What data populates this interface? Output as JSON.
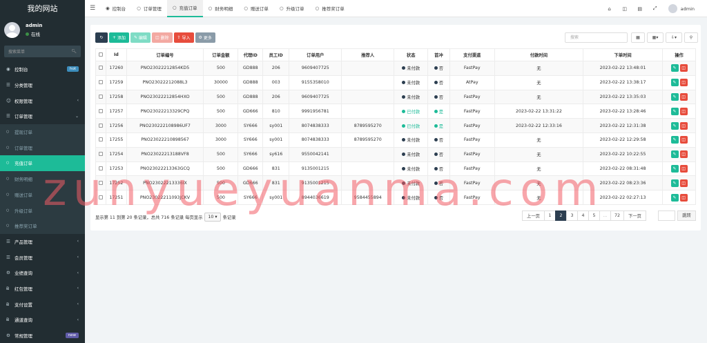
{
  "sidebar": {
    "logo": "我的网站",
    "user": {
      "name": "admin",
      "status": "在线"
    },
    "search_placeholder": "搜索菜单",
    "items": [
      {
        "label": "控制台",
        "icon": "dashboard-icon",
        "badge": "hot",
        "type": "parent"
      },
      {
        "label": "分类管理",
        "icon": "list-icon",
        "type": "parent"
      },
      {
        "label": "权限管理",
        "icon": "group-icon",
        "type": "parent",
        "chevron": true
      },
      {
        "label": "订单管理",
        "icon": "list-icon",
        "type": "parent",
        "chevron": true,
        "expanded": true
      },
      {
        "label": "提现订单",
        "icon": "circle-icon",
        "type": "sub"
      },
      {
        "label": "订单管理",
        "icon": "circle-icon",
        "type": "sub"
      },
      {
        "label": "充值订单",
        "icon": "circle-icon",
        "type": "sub",
        "active": true
      },
      {
        "label": "财务明细",
        "icon": "circle-icon",
        "type": "sub"
      },
      {
        "label": "赠送订单",
        "icon": "circle-icon",
        "type": "sub"
      },
      {
        "label": "升级订单",
        "icon": "circle-icon",
        "type": "sub"
      },
      {
        "label": "推荐奖订单",
        "icon": "circle-icon",
        "type": "sub"
      },
      {
        "label": "产品管理",
        "icon": "list-icon",
        "type": "parent",
        "chevron": true
      },
      {
        "label": "会员管理",
        "icon": "list-icon",
        "type": "parent",
        "chevron": true
      },
      {
        "label": "业绩查询",
        "icon": "gear-icon",
        "type": "parent",
        "chevron": true
      },
      {
        "label": "红包管理",
        "icon": "bitcoin-icon",
        "type": "parent",
        "chevron": true
      },
      {
        "label": "支付设置",
        "icon": "bitcoin-icon",
        "type": "parent",
        "chevron": true
      },
      {
        "label": "通道查询",
        "icon": "bitcoin-icon",
        "type": "parent",
        "chevron": true
      },
      {
        "label": "常规管理",
        "icon": "gear-icon",
        "badge": "new",
        "type": "parent"
      }
    ]
  },
  "topbar": {
    "tabs": [
      {
        "label": "控制台",
        "icon": "dashboard-icon"
      },
      {
        "label": "订单管理",
        "icon": "circle-icon"
      },
      {
        "label": "充值订单",
        "icon": "circle-icon",
        "active": true
      },
      {
        "label": "财务明细",
        "icon": "circle-icon"
      },
      {
        "label": "赠送订单",
        "icon": "circle-icon"
      },
      {
        "label": "升级订单",
        "icon": "circle-icon"
      },
      {
        "label": "推荐奖订单",
        "icon": "circle-icon"
      }
    ],
    "user": "admin"
  },
  "toolbar": {
    "add": "添加",
    "edit": "编辑",
    "delete": "删除",
    "import": "导入",
    "more": "更多",
    "search_placeholder": "搜索"
  },
  "table": {
    "headers": [
      "Id",
      "订单编号",
      "订单金额",
      "代理ID",
      "员工ID",
      "订单用户",
      "推荐人",
      "状态",
      "首冲",
      "支付渠道",
      "付款时间",
      "下单时间",
      "操作"
    ],
    "rows": [
      {
        "id": "17260",
        "order_no": "PNO23022212854KD5",
        "amount": "500",
        "agent": "GD888",
        "staff": "206",
        "user": "9609407725",
        "referrer": "",
        "status": "未付款",
        "paid": false,
        "first": "否",
        "channel": "FastPay",
        "pay_time": "无",
        "order_time": "2023-02-22 13:48:01"
      },
      {
        "id": "17259",
        "order_no": "PNO23022212088L3",
        "amount": "30000",
        "agent": "GD888",
        "staff": "003",
        "user": "9155358010",
        "referrer": "",
        "status": "未付款",
        "paid": false,
        "first": "否",
        "channel": "AtPay",
        "pay_time": "无",
        "order_time": "2023-02-22 13:38:17"
      },
      {
        "id": "17258",
        "order_no": "PNO23022212854HXO",
        "amount": "500",
        "agent": "GD888",
        "staff": "206",
        "user": "9609407725",
        "referrer": "",
        "status": "未付款",
        "paid": false,
        "first": "否",
        "channel": "FastPay",
        "pay_time": "无",
        "order_time": "2023-02-22 13:35:03"
      },
      {
        "id": "17257",
        "order_no": "PNO23022213329CPQ",
        "amount": "500",
        "agent": "GD666",
        "staff": "810",
        "user": "9991956781",
        "referrer": "",
        "status": "已付款",
        "paid": true,
        "first": "是",
        "channel": "FastPay",
        "pay_time": "2023-02-22 13:31:22",
        "order_time": "2023-02-22 13:28:46"
      },
      {
        "id": "17256",
        "order_no": "PNO230222108986UF7",
        "amount": "3000",
        "agent": "SY666",
        "staff": "sy001",
        "user": "8074838333",
        "referrer": "8789595270",
        "status": "已付款",
        "paid": true,
        "first": "是",
        "channel": "FastPay",
        "pay_time": "2023-02-22 12:33:16",
        "order_time": "2023-02-22 12:31:38"
      },
      {
        "id": "17255",
        "order_no": "PNO23022210898567",
        "amount": "3000",
        "agent": "SY666",
        "staff": "sy001",
        "user": "8074838333",
        "referrer": "8789595270",
        "status": "未付款",
        "paid": false,
        "first": "否",
        "channel": "FastPay",
        "pay_time": "无",
        "order_time": "2023-02-22 12:29:58"
      },
      {
        "id": "17254",
        "order_no": "PNO23022213188VF8",
        "amount": "500",
        "agent": "SY666",
        "staff": "sy616",
        "user": "9550042141",
        "referrer": "",
        "status": "未付款",
        "paid": false,
        "first": "否",
        "channel": "FastPay",
        "pay_time": "无",
        "order_time": "2023-02-22 10:22:55"
      },
      {
        "id": "17253",
        "order_no": "PNO23022213363GCQ",
        "amount": "500",
        "agent": "GD666",
        "staff": "831",
        "user": "9135001215",
        "referrer": "",
        "status": "未付款",
        "paid": false,
        "first": "否",
        "channel": "FastPay",
        "pay_time": "无",
        "order_time": "2023-02-22 08:31:48"
      },
      {
        "id": "17252",
        "order_no": "PNO23022213336IX",
        "amount": "500",
        "agent": "GD666",
        "staff": "831",
        "user": "9135001215",
        "referrer": "",
        "status": "未付款",
        "paid": false,
        "first": "否",
        "channel": "FastPay",
        "pay_time": "无",
        "order_time": "2023-02-22 08:23:36"
      },
      {
        "id": "17251",
        "order_no": "PNO23022211093JCKV",
        "amount": "500",
        "agent": "SY666",
        "staff": "sy001",
        "user": "8944036619",
        "referrer": "9584455894",
        "status": "未付款",
        "paid": false,
        "first": "否",
        "channel": "FastPay",
        "pay_time": "无",
        "order_time": "2023-02-22 02:27:13"
      }
    ]
  },
  "footer": {
    "info_prefix": "显示第 11 到第 20 条记录，总共 716 条记录 每页显示",
    "per_page": "10",
    "info_suffix": "条记录",
    "prev": "上一页",
    "next": "下一页",
    "pages": [
      "1",
      "2",
      "3",
      "4",
      "5",
      "...",
      "72"
    ],
    "active_page": "2",
    "jump": "跳转"
  },
  "watermark": "zunyueyuanma.com",
  "colors": {
    "accent": "#1dbb98",
    "sidebar_bg": "#222d32",
    "danger": "#e74c3c",
    "dark": "#2c3e50"
  }
}
